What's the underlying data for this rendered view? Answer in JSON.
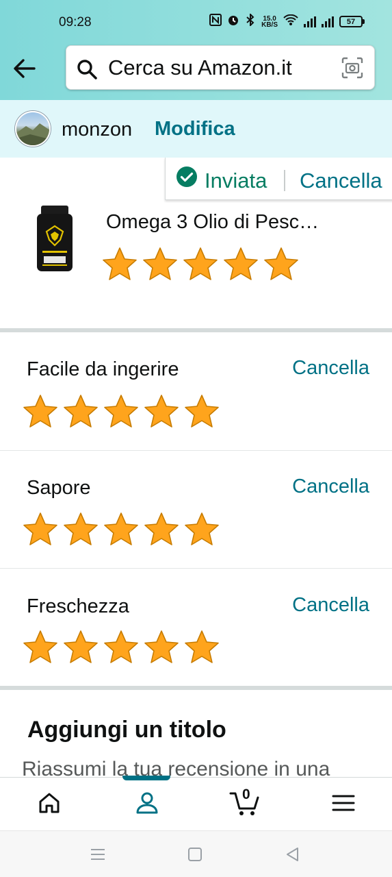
{
  "status_bar": {
    "time": "09:28",
    "speed_top": "15.0",
    "speed_bottom": "KB/S",
    "battery": "57"
  },
  "search": {
    "placeholder": "Cerca su Amazon.it"
  },
  "account": {
    "name": "monzon",
    "edit_label": "Modifica"
  },
  "review_status": {
    "sent_label": "Inviata",
    "cancel_label": "Cancella"
  },
  "product": {
    "title": "Omega 3 Olio di Pesc…",
    "rating": 5
  },
  "attributes": [
    {
      "label": "Facile da ingerire",
      "cancel_label": "Cancella",
      "rating": 5
    },
    {
      "label": "Sapore",
      "cancel_label": "Cancella",
      "rating": 5
    },
    {
      "label": "Freschezza",
      "cancel_label": "Cancella",
      "rating": 5
    }
  ],
  "title_section": {
    "heading": "Aggiungi un titolo",
    "subtext": "Riassumi la tua recensione in una"
  },
  "bottom_nav": {
    "cart_count": "0",
    "active": "profile"
  },
  "colors": {
    "accent": "#007185",
    "success": "#067d62",
    "star": "#FFA41C",
    "header_gradient": [
      "#80d8d9",
      "#a2e4df"
    ]
  }
}
